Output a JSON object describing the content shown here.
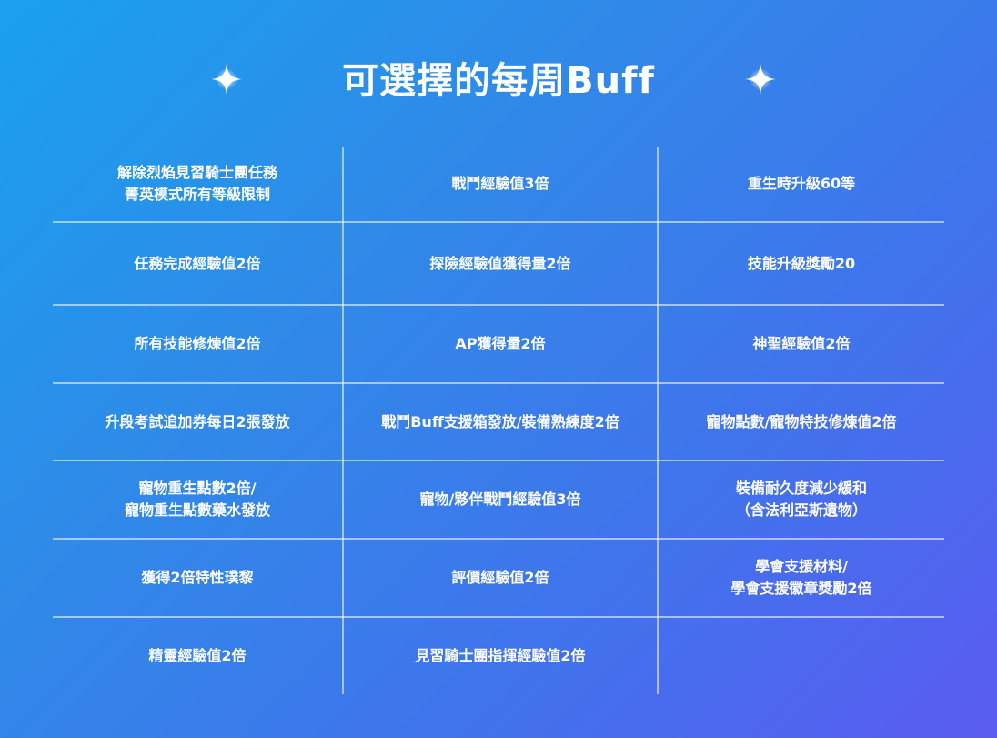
{
  "title": "可選擇的每周Buff",
  "grid": [
    [
      "解除烈焰見習騎士團任務\n菁英模式所有等級限制",
      "戰鬥經驗值3倍",
      "重生時升級60等"
    ],
    [
      "任務完成經驗值2倍",
      "探險經驗值獲得量2倍",
      "技能升級獎勵20"
    ],
    [
      "所有技能修煉值2倍",
      "AP獲得量2倍",
      "神聖經驗值2倍"
    ],
    [
      "升段考試追加券每日2張發放",
      "戰鬥Buff支援箱發放/裝備熟練度2倍",
      "寵物點數/寵物特技修煉值2倍"
    ],
    [
      "寵物重生點數2倍/\n寵物重生點數藥水發放",
      "寵物/夥伴戰鬥經驗值3倍",
      "裝備耐久度減少緩和\n（含法利亞斯遺物）"
    ],
    [
      "獲得2倍特性璞黎",
      "評價經驗值2倍",
      "學會支援材料/\n學會支援徽章獎勵2倍"
    ],
    [
      "精靈經驗值2倍",
      "見習騎士團指揮經驗值2倍",
      ""
    ]
  ]
}
